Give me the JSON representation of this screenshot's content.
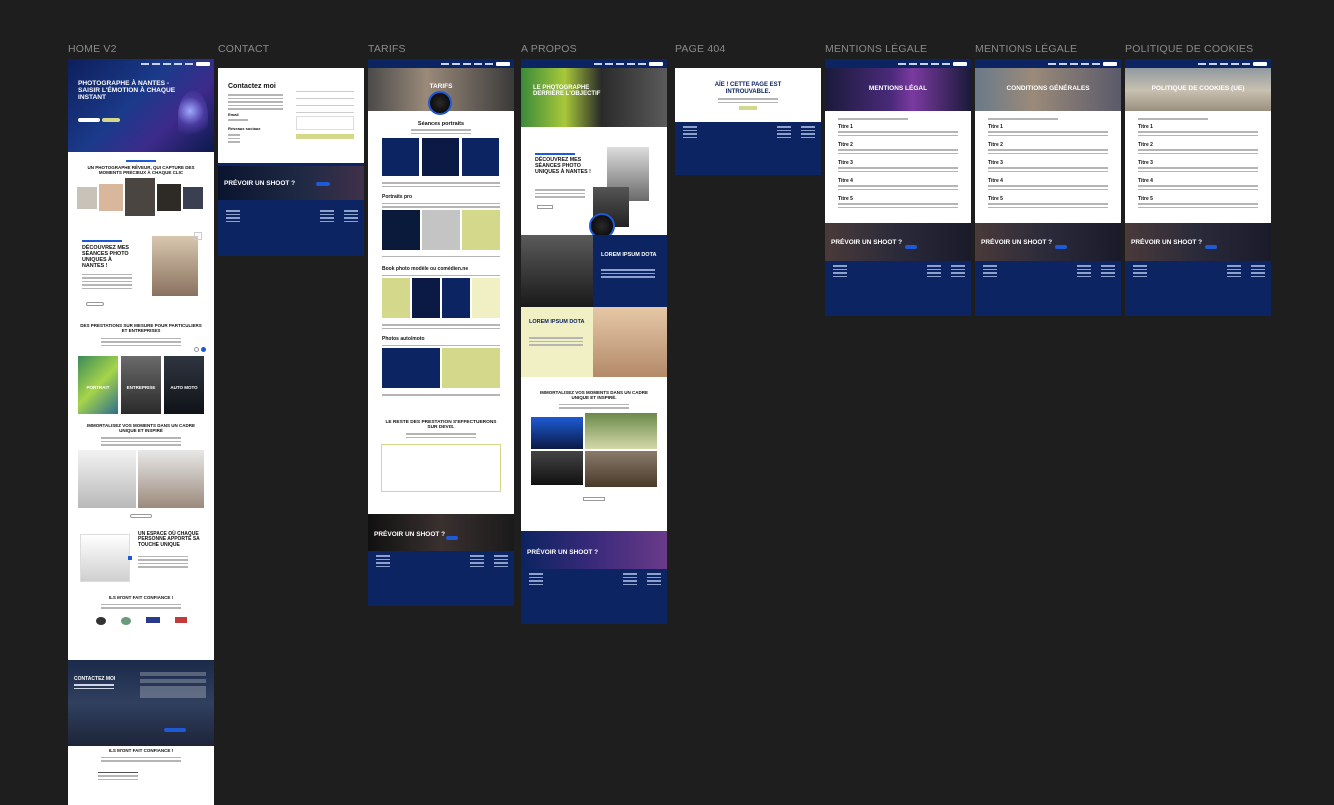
{
  "frames": {
    "home": {
      "label": "HOME V2",
      "hero_title": "PHOTOGRAPHE À NANTES - SAISIR L'ÉMOTION À CHAQUE INSTANT",
      "section1_title": "UN PHOTOGRAPHE RÊVEUR, QUI CAPTURE DES MOMENTS PRÉCIEUX À CHAQUE CLIC",
      "discover_title": "DÉCOUVREZ MES SÉANCES PHOTO UNIQUES À NANTES !",
      "services_title": "DES PRESTATIONS SUR MESURE POUR PARTICULIERS ET ENTREPRISES",
      "card1": "PORTRAIT",
      "card2": "ENTREPRISE",
      "card3": "AUTO MOTO",
      "frame_title": "IMMORTALISEZ VOS MOMENTS DANS UN CADRE UNIQUE ET INSPIRÉ",
      "space_title": "UN ESPACE OÙ CHAQUE PERSONNE APPORTE SA TOUCHE UNIQUE",
      "trust_title": "ILS M'ONT FAIT CONFIANCE !",
      "contact_title": "CONTACTEZ MOI",
      "trust_title_2": "ILS M'ONT FAIT CONFIANCE !"
    },
    "contact": {
      "label": "CONTACT",
      "heading": "Contactez moi",
      "email_label": "Email",
      "socials_label": "Réseaux sociaux",
      "banner": "PRÉVOIR UN SHOOT ?"
    },
    "tarifs": {
      "label": "TARIFS",
      "hero": "TARIFS",
      "section1": "Séances portraits",
      "section2": "Portraits pro",
      "section3": "Book photo modèle ou comédien.ne",
      "section4": "Photos auto/moto",
      "quote_title": "LE RESTE DES PRESTATION S'EFFECTUERONS SUR DEVIS.",
      "banner": "PRÉVOIR UN SHOOT ?"
    },
    "apropos": {
      "label": "A PROPOS",
      "hero": "LE PHOTOGRAPHE DERRIÈRE L'OBJECTIF",
      "discover": "DÉCOUVREZ MES SÉANCES PHOTO UNIQUES À NANTES !",
      "lorem1": "LOREM IPSUM DOTA",
      "lorem2": "LOREM IPSUM DOTA",
      "frame_title": "IMMORTALISEZ VOS MOMENTS DANS UN CADRE UNIQUE ET INSPIRÉ.",
      "banner": "PRÉVOIR UN SHOOT ?"
    },
    "page404": {
      "label": "PAGE 404",
      "title": "AÏE ! CETTE PAGE EST INTROUVABLE."
    },
    "mentions": {
      "label": "MENTIONS LÉGALE",
      "hero": "MENTIONS LÉGAL",
      "titles": [
        "Titre 1",
        "Titre 2",
        "Titre 3",
        "Titre 4",
        "Titre 5"
      ],
      "banner": "PRÉVOIR UN SHOOT ?"
    },
    "cgv": {
      "label": "MENTIONS LÉGALE",
      "hero": "CONDITIONS GÉNÉRALES",
      "titles": [
        "Titre 1",
        "Titre 2",
        "Titre 3",
        "Titre 4",
        "Titre 5"
      ],
      "banner": "PRÉVOIR UN SHOOT ?"
    },
    "cookies": {
      "label": "POLITIQUE DE COOKIES",
      "hero": "POLITIQUE DE COOKIES (UE)",
      "titles": [
        "Titre 1",
        "Titre 2",
        "Titre 3",
        "Titre 4",
        "Titre 5"
      ],
      "banner": "PRÉVOIR UN SHOOT ?"
    }
  },
  "colors": {
    "canvas": "#1e1e1e",
    "navy": "#0c2461",
    "lime": "#d4d88a",
    "blue_accent": "#1e5ad6"
  }
}
